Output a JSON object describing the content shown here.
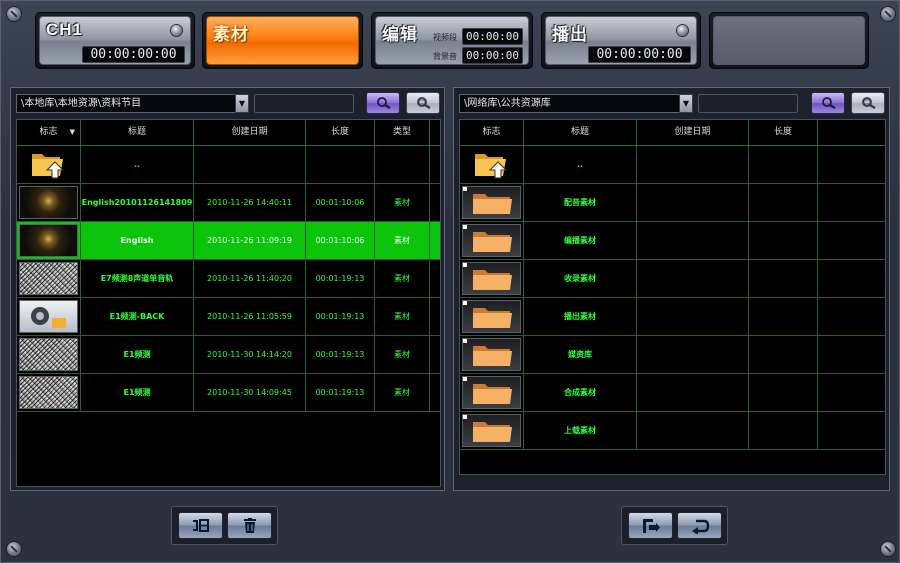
{
  "header": {
    "ch1": {
      "label": "CH1",
      "timecode": "00:00:00:00"
    },
    "material": {
      "label": "素材"
    },
    "edit": {
      "label": "编辑",
      "video_segment_label": "视频段",
      "video_segment_tc": "00:00:00",
      "audio_label": "背景音",
      "audio_tc": "00:00:00"
    },
    "playout": {
      "label": "播出",
      "timecode": "00:00:00:00"
    }
  },
  "left_panel": {
    "path": "\\本地库\\本地资源\\资料节目",
    "columns": [
      "标志",
      "标题",
      "创建日期",
      "长度",
      "类型"
    ],
    "rows": [
      {
        "thumb": "up-folder-icon",
        "title": "..",
        "date": "",
        "length": "",
        "type": ""
      },
      {
        "thumb": "city-night",
        "title": "English20101126141809",
        "date": "2010-11-26 14:40:11",
        "length": "00:01:10:06",
        "type": "素材"
      },
      {
        "thumb": "city-night",
        "title": "English",
        "date": "2010-11-26 11:09:19",
        "length": "00:01:10:06",
        "type": "素材",
        "selected": true
      },
      {
        "thumb": "noise",
        "title": "E7频测8声道单音轨",
        "date": "2010-11-26 11:40:20",
        "length": "00:01:19:13",
        "type": "素材"
      },
      {
        "thumb": "audio",
        "title": "E1频测-BACK",
        "date": "2010-11-26 11:05:59",
        "length": "00:01:19:13",
        "type": "素材"
      },
      {
        "thumb": "noise",
        "title": "E1频测",
        "date": "2010-11-30 14:14:20",
        "length": "00:01:19:13",
        "type": "素材"
      },
      {
        "thumb": "noise",
        "title": "E1频测",
        "date": "2010-11-30 14:09:45",
        "length": "00:01:19:13",
        "type": "素材"
      }
    ]
  },
  "right_panel": {
    "path": "\\网络库\\公共资源库",
    "columns": [
      "标志",
      "标题",
      "创建日期",
      "长度"
    ],
    "rows": [
      {
        "thumb": "up-folder-icon",
        "title": ".."
      },
      {
        "thumb": "folder",
        "title": "配音素材"
      },
      {
        "thumb": "folder",
        "title": "编播素材"
      },
      {
        "thumb": "folder",
        "title": "收录素材"
      },
      {
        "thumb": "folder",
        "title": "播出素材"
      },
      {
        "thumb": "folder",
        "title": "媒资库"
      },
      {
        "thumb": "folder",
        "title": "合成素材"
      },
      {
        "thumb": "folder",
        "title": "上载素材"
      }
    ]
  },
  "icons": {
    "search": "search-icon",
    "advanced_search": "advanced-search-icon",
    "rename": "rename-icon",
    "delete": "trash-icon",
    "import": "import-icon",
    "back": "back-icon"
  },
  "colors": {
    "accent_orange": "#ff7d10",
    "selection_green": "#0cc40c",
    "text_green": "#2cff3c",
    "button_purple": "#8a72d6"
  }
}
